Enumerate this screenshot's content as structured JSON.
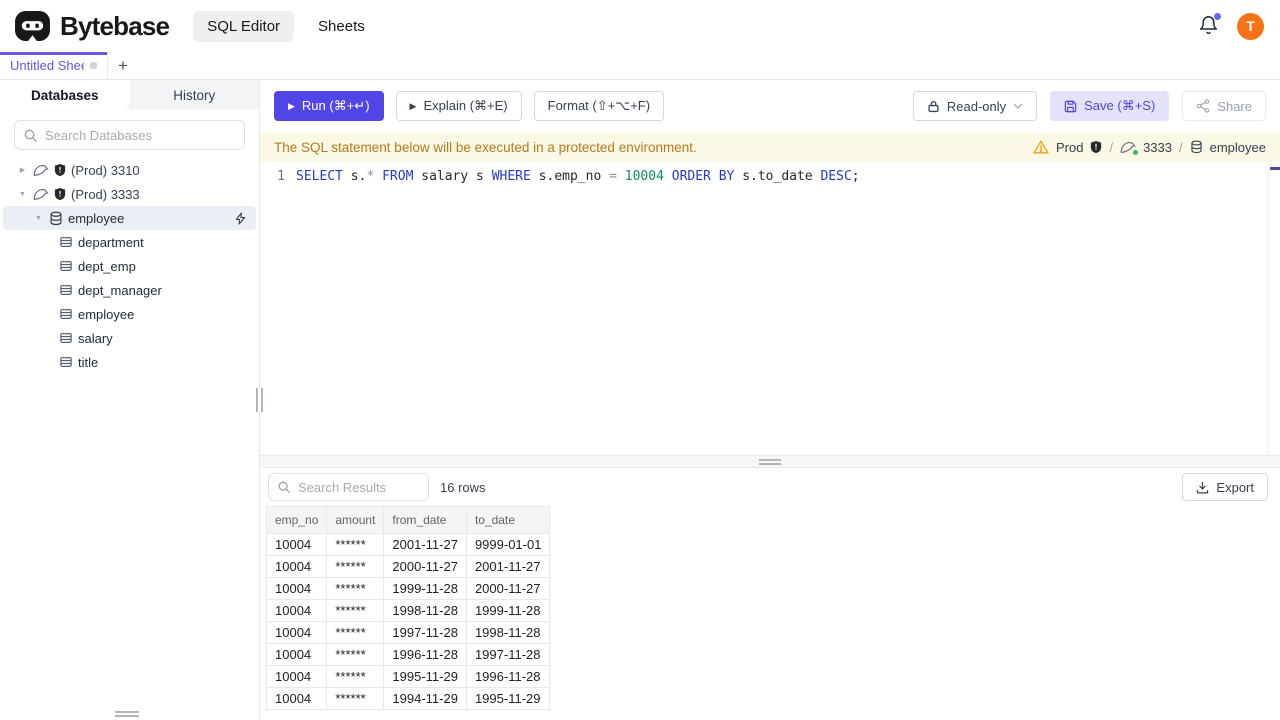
{
  "header": {
    "brand": "Bytebase",
    "nav": [
      {
        "label": "SQL Editor",
        "active": true
      },
      {
        "label": "Sheets",
        "active": false
      }
    ],
    "avatar_initial": "T",
    "has_notification": true
  },
  "tabbar": {
    "tabs": [
      {
        "label": "Untitled Sheet",
        "active": true,
        "unsaved": true
      }
    ],
    "new_tab_label": "+"
  },
  "sidebar": {
    "tabs": [
      {
        "label": "Databases",
        "active": true
      },
      {
        "label": "History",
        "active": false
      }
    ],
    "search_placeholder": "Search Databases",
    "tree": [
      {
        "type": "instance",
        "label": "(Prod) 3310",
        "expanded": false
      },
      {
        "type": "instance",
        "label": "(Prod) 3333",
        "expanded": true
      },
      {
        "type": "database",
        "label": "employee",
        "selected": true
      },
      {
        "type": "table",
        "label": "department"
      },
      {
        "type": "table",
        "label": "dept_emp"
      },
      {
        "type": "table",
        "label": "dept_manager"
      },
      {
        "type": "table",
        "label": "employee"
      },
      {
        "type": "table",
        "label": "salary"
      },
      {
        "type": "table",
        "label": "title"
      }
    ]
  },
  "toolbar": {
    "run": "Run (⌘+↵)",
    "explain": "Explain (⌘+E)",
    "format": "Format (⇧+⌥+F)",
    "readonly": "Read-only",
    "save": "Save (⌘+S)",
    "share": "Share"
  },
  "banner": {
    "message": "The SQL statement below will be executed in a protected environment.",
    "environment": "Prod",
    "separator": "/",
    "instance": "3333",
    "database": "employee"
  },
  "editor": {
    "line_number": "1",
    "sql": "SELECT s.* FROM salary s WHERE s.emp_no = 10004 ORDER BY s.to_date DESC;",
    "tokens": [
      {
        "text": "SELECT",
        "type": "keyword"
      },
      {
        "text": " s.",
        "type": "plain"
      },
      {
        "text": "*",
        "type": "operator"
      },
      {
        "text": " ",
        "type": "plain"
      },
      {
        "text": "FROM",
        "type": "keyword"
      },
      {
        "text": " salary s ",
        "type": "plain"
      },
      {
        "text": "WHERE",
        "type": "keyword"
      },
      {
        "text": " s.emp_no ",
        "type": "plain"
      },
      {
        "text": "=",
        "type": "operator"
      },
      {
        "text": " ",
        "type": "plain"
      },
      {
        "text": "10004",
        "type": "number"
      },
      {
        "text": " ",
        "type": "plain"
      },
      {
        "text": "ORDER BY",
        "type": "keyword"
      },
      {
        "text": " s.to_date ",
        "type": "plain"
      },
      {
        "text": "DESC",
        "type": "keyword"
      },
      {
        "text": ";",
        "type": "plain"
      }
    ]
  },
  "results": {
    "search_placeholder": "Search Results",
    "row_count": "16 rows",
    "export": "Export",
    "columns": [
      "emp_no",
      "amount",
      "from_date",
      "to_date"
    ],
    "rows": [
      [
        "10004",
        "******",
        "2001-11-27",
        "9999-01-01"
      ],
      [
        "10004",
        "******",
        "2000-11-27",
        "2001-11-27"
      ],
      [
        "10004",
        "******",
        "1999-11-28",
        "2000-11-27"
      ],
      [
        "10004",
        "******",
        "1998-11-28",
        "1999-11-28"
      ],
      [
        "10004",
        "******",
        "1997-11-28",
        "1998-11-28"
      ],
      [
        "10004",
        "******",
        "1996-11-28",
        "1997-11-28"
      ],
      [
        "10004",
        "******",
        "1995-11-29",
        "1996-11-28"
      ],
      [
        "10004",
        "******",
        "1994-11-29",
        "1995-11-29"
      ]
    ]
  },
  "icons": {
    "play": "▶",
    "caret_right": "▶",
    "caret_down": "▼",
    "logo": "bytebase-robot",
    "bell": "notification-bell",
    "search": "magnifier",
    "mysql": "mysql-dolphin",
    "shield": "environment-shield",
    "database": "database-cylinder",
    "table": "table-grid",
    "bolt": "lightning-bolt",
    "lock": "padlock",
    "chevron": "chevron-down",
    "save": "floppy-disk",
    "share": "share-nodes",
    "download": "download-tray",
    "warning": "warning-triangle"
  },
  "colors": {
    "accent": "#4f46e5",
    "tab_accent": "#6d52e8",
    "avatar_bg": "#f97316",
    "notification_badge": "#6366f1",
    "banner_bg": "#fcf8e6",
    "banner_text": "#b7791f",
    "status_ok": "#2fbf5f",
    "sql_keyword": "#2838cc",
    "sql_number": "#0e9157",
    "sql_operator": "#8b9096",
    "selected_row_bg": "#eceef6"
  }
}
